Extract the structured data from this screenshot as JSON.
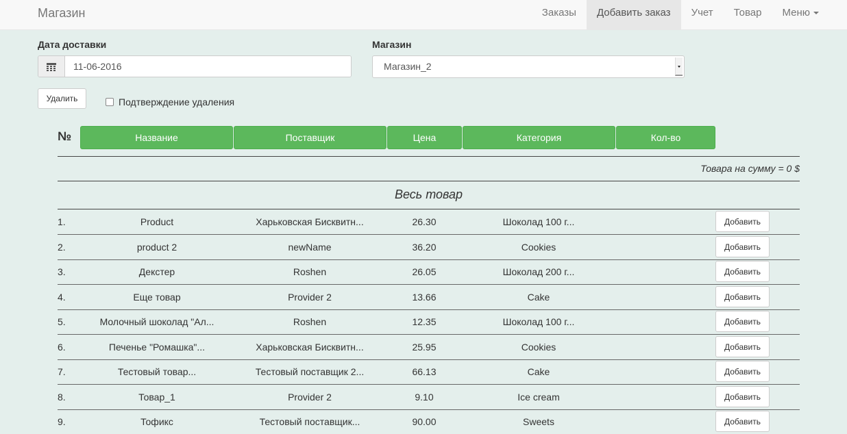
{
  "navbar": {
    "brand": "Магазин",
    "items": [
      {
        "label": "Заказы"
      },
      {
        "label": "Добавить заказ"
      },
      {
        "label": "Учет"
      },
      {
        "label": "Товар"
      },
      {
        "label": "Меню"
      }
    ]
  },
  "form": {
    "date_label": "Дата доставки",
    "date_value": "11-06-2016",
    "store_label": "Магазин",
    "store_value": "Магазин_2",
    "delete_label": "Удалить",
    "confirm_label": "Подтверждение удаления"
  },
  "columns": {
    "num": "№",
    "name": "Название",
    "supplier": "Поставщик",
    "price": "Цена",
    "category": "Категория",
    "qty": "Кол-во"
  },
  "total_text": "Товара на сумму = 0 $",
  "all_goods_title": "Весь товар",
  "add_label": "Добавить",
  "rows": [
    {
      "num": "1.",
      "name": "Product",
      "supplier": "Харьковская Бисквитн...",
      "price": "26.30",
      "category": "Шоколад 100 г..."
    },
    {
      "num": "2.",
      "name": "product 2",
      "supplier": "newName",
      "price": "36.20",
      "category": "Cookies"
    },
    {
      "num": "3.",
      "name": "Декстер",
      "supplier": "Roshen",
      "price": "26.05",
      "category": "Шоколад 200 г..."
    },
    {
      "num": "4.",
      "name": "Еще товар",
      "supplier": "Provider 2",
      "price": "13.66",
      "category": "Cake"
    },
    {
      "num": "5.",
      "name": "Молочный шоколад \"Ал...",
      "supplier": "Roshen",
      "price": "12.35",
      "category": "Шоколад 100 г..."
    },
    {
      "num": "6.",
      "name": "Печенье \"Ромашка\"...",
      "supplier": "Харьковская Бисквитн...",
      "price": "25.95",
      "category": "Cookies"
    },
    {
      "num": "7.",
      "name": "Тестовый товар...",
      "supplier": "Тестовый поставщик 2...",
      "price": "66.13",
      "category": "Cake"
    },
    {
      "num": "8.",
      "name": "Товар_1",
      "supplier": "Provider 2",
      "price": "9.10",
      "category": "Ice cream"
    },
    {
      "num": "9.",
      "name": "Тофикс",
      "supplier": "Тестовый поставщик...",
      "price": "90.00",
      "category": "Sweets"
    }
  ]
}
